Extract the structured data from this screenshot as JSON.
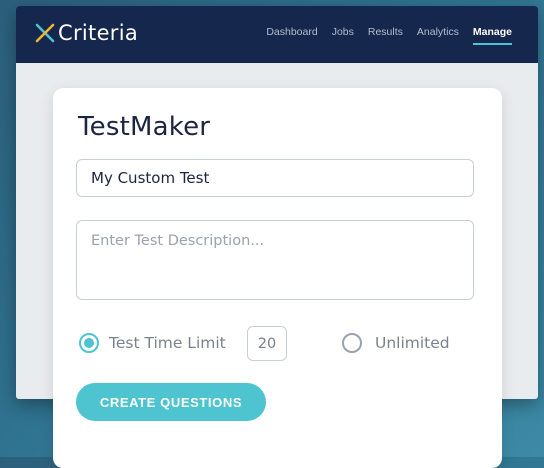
{
  "header": {
    "logo_text": "Criteria",
    "nav": [
      {
        "label": "Dashboard",
        "active": false
      },
      {
        "label": "Jobs",
        "active": false
      },
      {
        "label": "Results",
        "active": false
      },
      {
        "label": "Analytics",
        "active": false
      },
      {
        "label": "Manage",
        "active": true
      }
    ]
  },
  "card": {
    "title": "TestMaker",
    "test_name_value": "My Custom Test",
    "description_placeholder": "Enter Test Description...",
    "time_limit": {
      "option_label": "Test Time Limit",
      "selected": true,
      "value": "20"
    },
    "unlimited": {
      "option_label": "Unlimited",
      "selected": false
    },
    "create_button_label": "CREATE QUESTIONS"
  },
  "colors": {
    "navy": "#16274e",
    "accent": "#4dc4cf"
  },
  "icons": {
    "logo": "criteria-x-logo-icon"
  }
}
